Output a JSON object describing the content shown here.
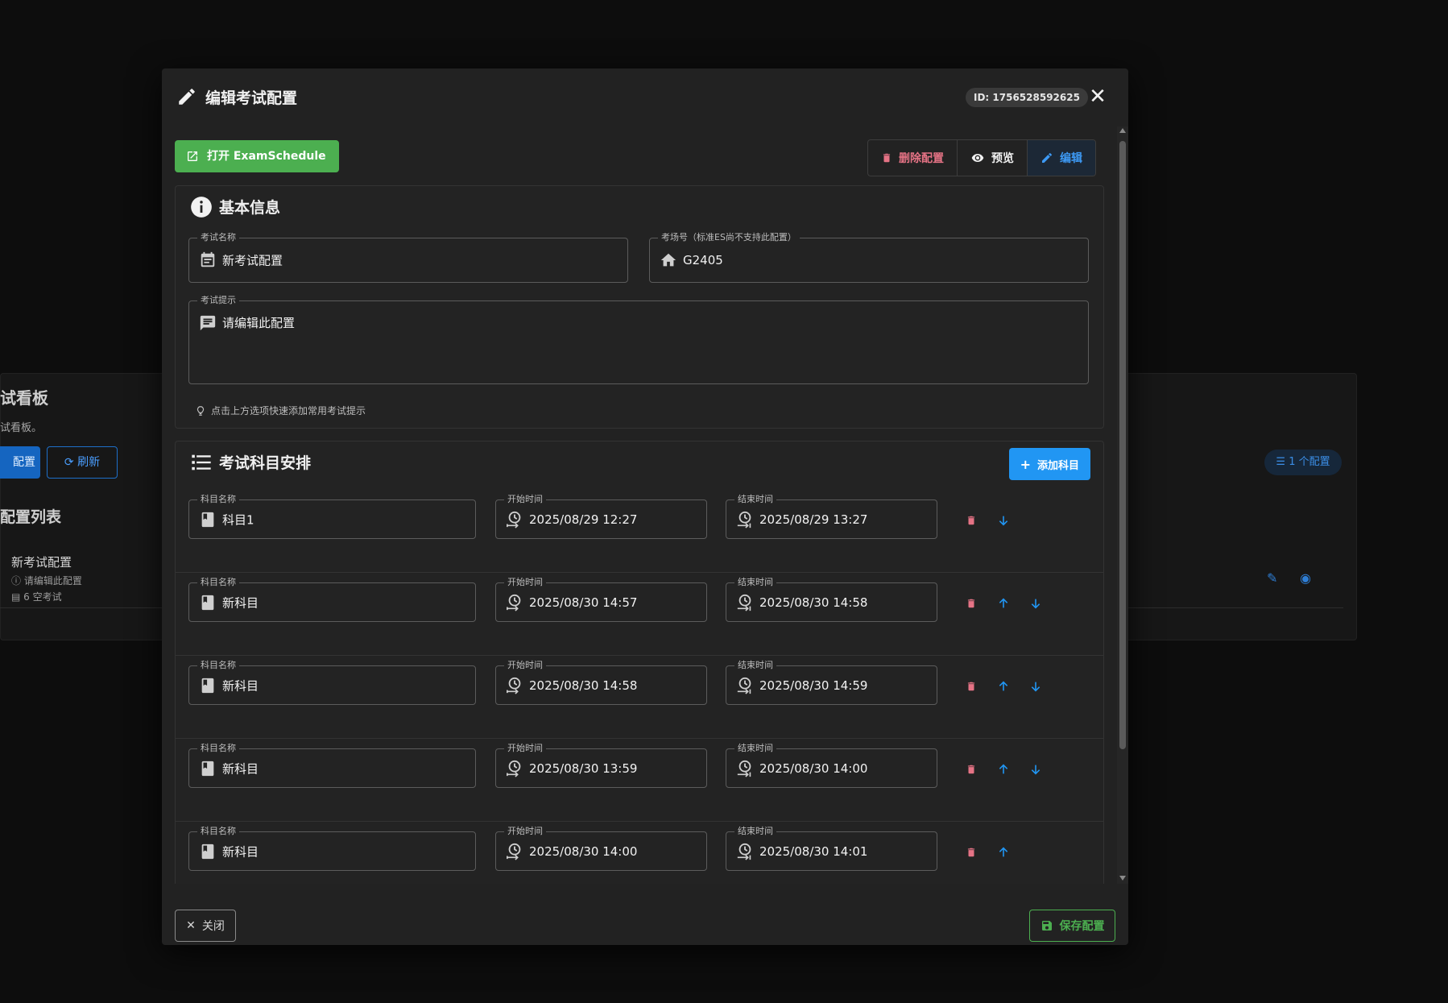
{
  "background": {
    "title": "试看板",
    "subtitle": "试看板。",
    "primary_button": "配置",
    "refresh_button": "刷新",
    "list_title": "配置列表",
    "item": {
      "title": "新考试配置",
      "desc": "请编辑此配置",
      "count": "6 空考试"
    },
    "chip": "1 个配置"
  },
  "dialog": {
    "title": "编辑考试配置",
    "id_chip": "ID: 1756528592625",
    "open_button": "打开 ExamSchedule",
    "toolbar": {
      "delete": "删除配置",
      "preview": "预览",
      "edit": "编辑"
    },
    "basic": {
      "title": "基本信息",
      "exam_name_label": "考试名称",
      "exam_name_value": "新考试配置",
      "room_label": "考场号（标准ES尚不支持此配置）",
      "room_value": "G2405",
      "tip_label": "考试提示",
      "tip_value": "请编辑此配置",
      "hint": "点击上方选项快速添加常用考试提示"
    },
    "subjects": {
      "title": "考试科目安排",
      "add_button": "添加科目",
      "name_label": "科目名称",
      "start_label": "开始时间",
      "end_label": "结束时间",
      "rows": [
        {
          "name": "科目1",
          "start": "2025/08/29 12:27",
          "end": "2025/08/29 13:27"
        },
        {
          "name": "新科目",
          "start": "2025/08/30 14:57",
          "end": "2025/08/30 14:58"
        },
        {
          "name": "新科目",
          "start": "2025/08/30 14:58",
          "end": "2025/08/30 14:59"
        },
        {
          "name": "新科目",
          "start": "2025/08/30 13:59",
          "end": "2025/08/30 14:00"
        },
        {
          "name": "新科目",
          "start": "2025/08/30 14:00",
          "end": "2025/08/30 14:01"
        }
      ]
    },
    "footer": {
      "close": "关闭",
      "save": "保存配置"
    }
  },
  "colors": {
    "accent_blue": "#2196f3",
    "success_green": "#4caf50",
    "danger_red": "#e57385"
  }
}
